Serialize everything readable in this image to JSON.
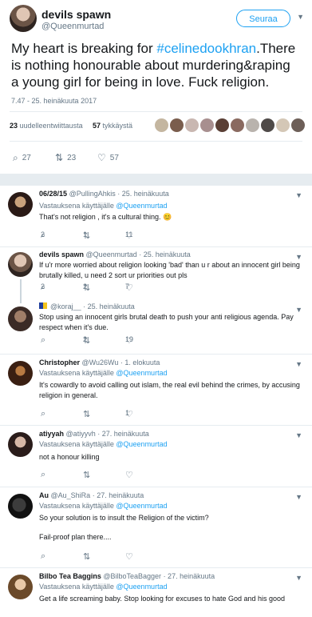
{
  "tweet": {
    "display_name": "devils spawn",
    "handle": "@Queenmurtad",
    "follow_label": "Seuraa",
    "text_prefix": "My heart is breaking for ",
    "hashtag": "#celinedookhran",
    "text_suffix": ".There is nothing honourable about murdering&raping a young girl for being in love. Fuck religion.",
    "timestamp": "7.47 - 25. heinäkuuta 2017",
    "retweets_count": "23",
    "retweets_label": "uudelleentwiittausta",
    "likes_count": "57",
    "likes_label": "tykkäystä",
    "reply_count": "27",
    "retweet_count": "23",
    "like_count": "57"
  },
  "icons": {
    "reply": "reply-icon",
    "retweet": "retweet-icon",
    "like": "heart-icon",
    "caret": "chevron-down-icon"
  },
  "colors": {
    "accent": "#1da1f2",
    "secondary_text": "#657786",
    "border": "#e6ecf0"
  },
  "replies": [
    {
      "name": "06/28/15",
      "handle": "@PullingAhkis",
      "date": "· 25. heinäkuuta",
      "replying": "Vastauksena käyttäjälle",
      "replying_to": "@Queenmurtad",
      "text": "That's not religion , it's a cultural thing. 😊",
      "replies": "2",
      "retweets": "1",
      "likes": "11"
    },
    {
      "name": "devils spawn",
      "handle": "@Queenmurtad",
      "date": "· 25. heinäkuuta",
      "text": "If u'r more worried about religion looking 'bad' than u r about an innocent girl being brutally killed, u need 2 sort ur priorities out pls",
      "replies": "2",
      "retweets": "2",
      "likes": "7"
    },
    {
      "name": "",
      "handle": "@koraj__",
      "date": "· 25. heinäkuuta",
      "text": "Stop using an innocent girls brutal death to push your anti religious agenda. Pay respect when it's due.",
      "replies": "",
      "retweets": "2",
      "likes": "19"
    },
    {
      "name": "Christopher",
      "handle": "@Wu26Wu",
      "date": "· 1. elokuuta",
      "replying": "Vastauksena käyttäjälle",
      "replying_to": "@Queenmurtad",
      "text": "It's cowardly to avoid calling out islam, the real evil behind the crimes, by accusing religion in general.",
      "replies": "",
      "retweets": "",
      "likes": "1"
    },
    {
      "name": "atiyyah",
      "handle": "@atiyyvh",
      "date": "· 27. heinäkuuta",
      "replying": "Vastauksena käyttäjälle",
      "replying_to": "@Queenmurtad",
      "text": "not a honour killing",
      "replies": "",
      "retweets": "",
      "likes": ""
    },
    {
      "name": "Au",
      "handle": "@Au_ShiRa",
      "date": "· 27. heinäkuuta",
      "replying": "Vastauksena käyttäjälle",
      "replying_to": "@Queenmurtad",
      "text": "So your solution is to insult the Religion of the victim?",
      "text2": "Fail-proof plan there....",
      "replies": "",
      "retweets": "",
      "likes": ""
    },
    {
      "name": "Bilbo Tea Baggins",
      "handle": "@BilboTeaBagger",
      "date": "· 27. heinäkuuta",
      "replying": "Vastauksena käyttäjälle",
      "replying_to": "@Queenmurtad",
      "text": "Get a life screaming baby. Stop looking for excuses to hate God and his good"
    }
  ]
}
